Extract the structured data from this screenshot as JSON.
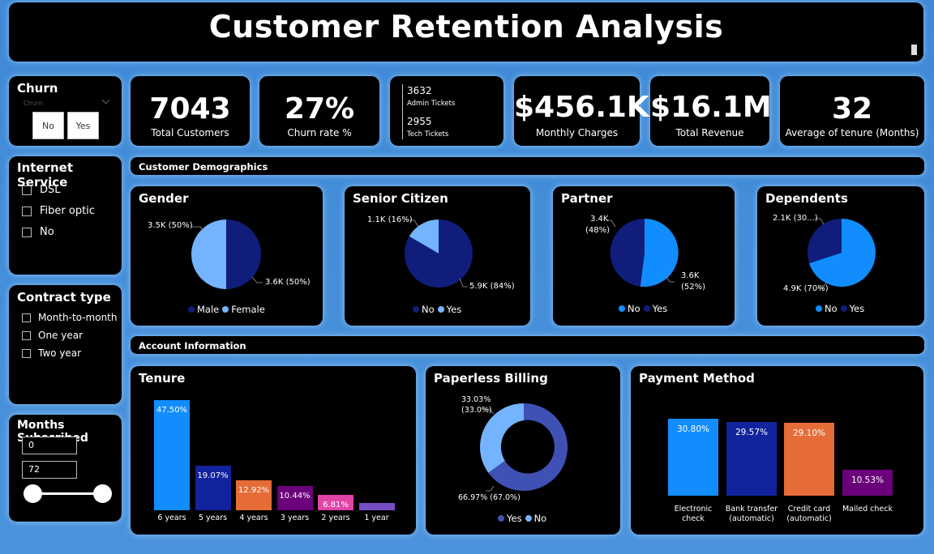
{
  "header": {
    "title": "Customer Retention Analysis"
  },
  "churn_slicer": {
    "title": "Churn",
    "sub": "Churn",
    "options": [
      "No",
      "Yes"
    ]
  },
  "internet_slicer": {
    "title": "Internet Service",
    "options": [
      "DSL",
      "Fiber optic",
      "No"
    ]
  },
  "contract_slicer": {
    "title": "Contract type",
    "options": [
      "Month-to-month",
      "One year",
      "Two year"
    ]
  },
  "months_slicer": {
    "title": "Months Subscribed",
    "min": "0",
    "max": "72"
  },
  "kpis": {
    "total_customers": {
      "value": "7043",
      "label": "Total Customers"
    },
    "churn_rate": {
      "value": "27%",
      "label": "Churn rate %"
    },
    "tickets": {
      "admin_value": "3632",
      "admin_label": "Admin Tickets",
      "tech_value": "2955",
      "tech_label": "Tech Tickets"
    },
    "monthly_charges": {
      "value": "$456.1K",
      "label": "Monthly Charges"
    },
    "total_revenue": {
      "value": "$16.1M",
      "label": "Total Revenue"
    },
    "avg_tenure": {
      "value": "32",
      "label": "Average of tenure (Months)"
    }
  },
  "sections": {
    "demographics": "Customer Demographics",
    "account": "Account Information"
  },
  "colors": {
    "navy": "#101d7a",
    "light_blue": "#74b4ff",
    "blue": "#118dff",
    "deep_navy": "#12239e",
    "orange": "#e66c37",
    "purple": "#6b007b",
    "pink": "#e044a7",
    "violet": "#744ec2",
    "slate_blue": "#3f51b5"
  },
  "chart_data": [
    {
      "type": "pie",
      "title": "Gender",
      "slices": [
        {
          "name": "Male",
          "value": 50,
          "label": "3.6K (50%)"
        },
        {
          "name": "Female",
          "value": 50,
          "label": "3.5K (50%)"
        }
      ],
      "legend": [
        "Male",
        "Female"
      ]
    },
    {
      "type": "pie",
      "title": "Senior Citizen",
      "slices": [
        {
          "name": "No",
          "value": 84,
          "label": "5.9K (84%)"
        },
        {
          "name": "Yes",
          "value": 16,
          "label": "1.1K (16%)"
        }
      ],
      "legend": [
        "No",
        "Yes"
      ]
    },
    {
      "type": "pie",
      "title": "Partner",
      "slices": [
        {
          "name": "No",
          "value": 52,
          "label_a": "3.6K",
          "label_b": "(52%)"
        },
        {
          "name": "Yes",
          "value": 48,
          "label_a": "3.4K",
          "label_b": "(48%)"
        }
      ],
      "legend": [
        "No",
        "Yes"
      ]
    },
    {
      "type": "pie",
      "title": "Dependents",
      "slices": [
        {
          "name": "No",
          "value": 70,
          "label": "4.9K (70%)"
        },
        {
          "name": "Yes",
          "value": 30,
          "label": "2.1K (30...)"
        }
      ],
      "legend": [
        "No",
        "Yes"
      ]
    },
    {
      "type": "bar",
      "title": "Tenure",
      "categories": [
        "6 years",
        "5 years",
        "4 years",
        "3 years",
        "2 years",
        "1 year"
      ],
      "values": [
        47.5,
        19.07,
        12.92,
        10.44,
        6.81,
        3.0
      ],
      "labels": [
        "47.50%",
        "19.07%",
        "12.92%",
        "10.44%",
        "6.81%",
        ""
      ],
      "colors": [
        "#118dff",
        "#12239e",
        "#e66c37",
        "#6b007b",
        "#e044a7",
        "#744ec2"
      ]
    },
    {
      "type": "pie",
      "title": "Paperless Billing",
      "slices": [
        {
          "name": "Yes",
          "value": 66.97,
          "label": "66.97% (67.0%)"
        },
        {
          "name": "No",
          "value": 33.03,
          "label_a": "33.03%",
          "label_b": "(33.0%)"
        }
      ],
      "legend": [
        "Yes",
        "No"
      ]
    },
    {
      "type": "bar",
      "title": "Payment Method",
      "categories": [
        [
          "Electronic",
          "check"
        ],
        [
          "Bank transfer",
          "(automatic)"
        ],
        [
          "Credit card",
          "(automatic)"
        ],
        [
          "Mailed check"
        ]
      ],
      "values": [
        30.8,
        29.57,
        29.1,
        10.53
      ],
      "labels": [
        "30.80%",
        "29.57%",
        "29.10%",
        "10.53%"
      ],
      "colors": [
        "#118dff",
        "#12239e",
        "#e66c37",
        "#6b007b"
      ]
    }
  ]
}
